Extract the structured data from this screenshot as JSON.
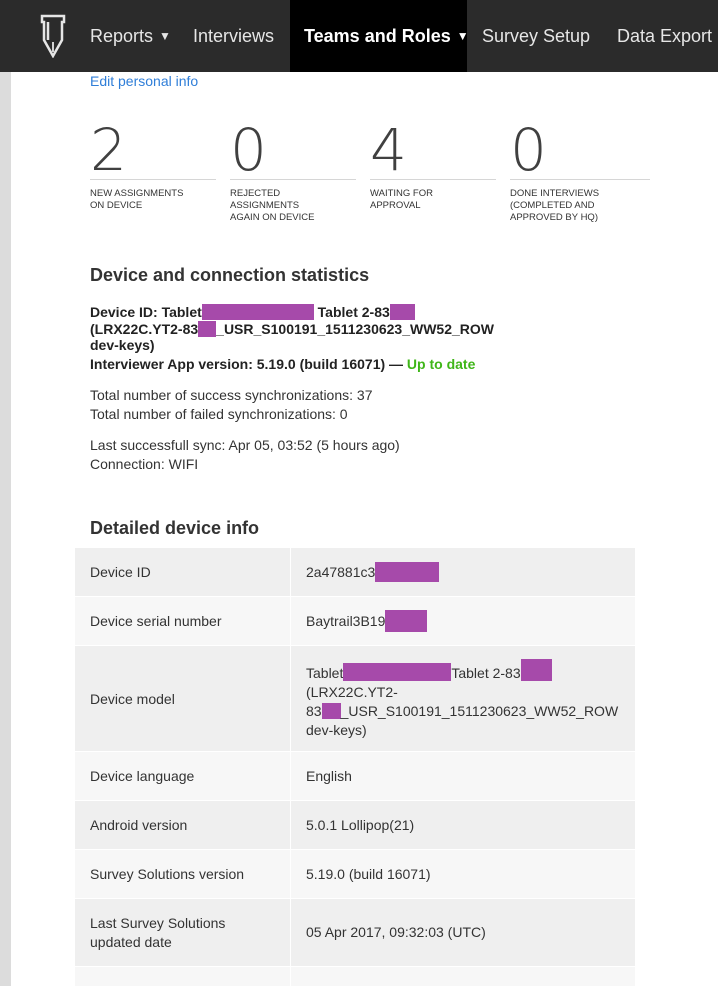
{
  "nav": {
    "items": [
      "Reports",
      "Interviews",
      "Teams and Roles",
      "Survey Setup",
      "Data Export"
    ],
    "active": "Teams and Roles"
  },
  "edit_personal_info": "Edit personal info",
  "stats": [
    {
      "value": "2",
      "label_1": "NEW ASSIGNMENTS",
      "label_2": "ON DEVICE",
      "label_3": ""
    },
    {
      "value": "0",
      "label_1": "REJECTED",
      "label_2": "ASSIGNMENTS",
      "label_3": "AGAIN ON DEVICE"
    },
    {
      "value": "4",
      "label_1": "WAITING FOR",
      "label_2": "APPROVAL",
      "label_3": ""
    },
    {
      "value": "0",
      "label_1": "DONE INTERVIEWS",
      "label_2": "(COMPLETED AND",
      "label_3": "APPROVED BY HQ)"
    }
  ],
  "device_stats": {
    "heading": "Device and connection statistics",
    "device_id_prefix": "Device ID: Tablet",
    "device_id_mid": "Tablet 2-83",
    "device_id_line2_a": "(LRX22C.YT2-83",
    "device_id_line2_b": "_USR_S100191_1511230623_WW52_ROW",
    "device_id_line3": "dev-keys)",
    "app_version_label": "Interviewer App version: 5.19.0 (build 16071) —",
    "app_status": "Up to date",
    "success_syncs": "Total number of success synchronizations: 37",
    "failed_syncs": "Total number of failed synchronizations: 0",
    "last_sync": "Last successfull sync: Apr 05, 03:52 (5 hours ago)",
    "connection": "Connection: WIFI"
  },
  "detailed": {
    "heading": "Detailed device info",
    "rows": [
      {
        "key": "Device ID",
        "value": "2a47881c3"
      },
      {
        "key": "Device serial number",
        "value": "Baytrail3B19"
      },
      {
        "key": "Device model",
        "value_a": "Tablet",
        "value_b": "Tablet 2-83",
        "value_c": "(LRX22C.YT2-",
        "value_d": "83",
        "value_e": "_USR_S100191_1511230623_WW52_ROW",
        "value_f": "dev-keys)"
      },
      {
        "key": "Device language",
        "value": "English"
      },
      {
        "key": "Android version",
        "value": "5.0.1 Lollipop(21)"
      },
      {
        "key": "Survey Solutions version",
        "value": "5.19.0 (build 16071)"
      },
      {
        "key_a": "Last Survey Solutions",
        "key_b": "updated date",
        "value": "05 Apr 2017, 09:32:03 (UTC)"
      }
    ]
  },
  "colors": {
    "nav_bg": "#2b2b2b",
    "nav_active_bg": "#000000",
    "link": "#2f7ed8",
    "ok": "#3fb618",
    "redaction": "#a64aaa"
  }
}
